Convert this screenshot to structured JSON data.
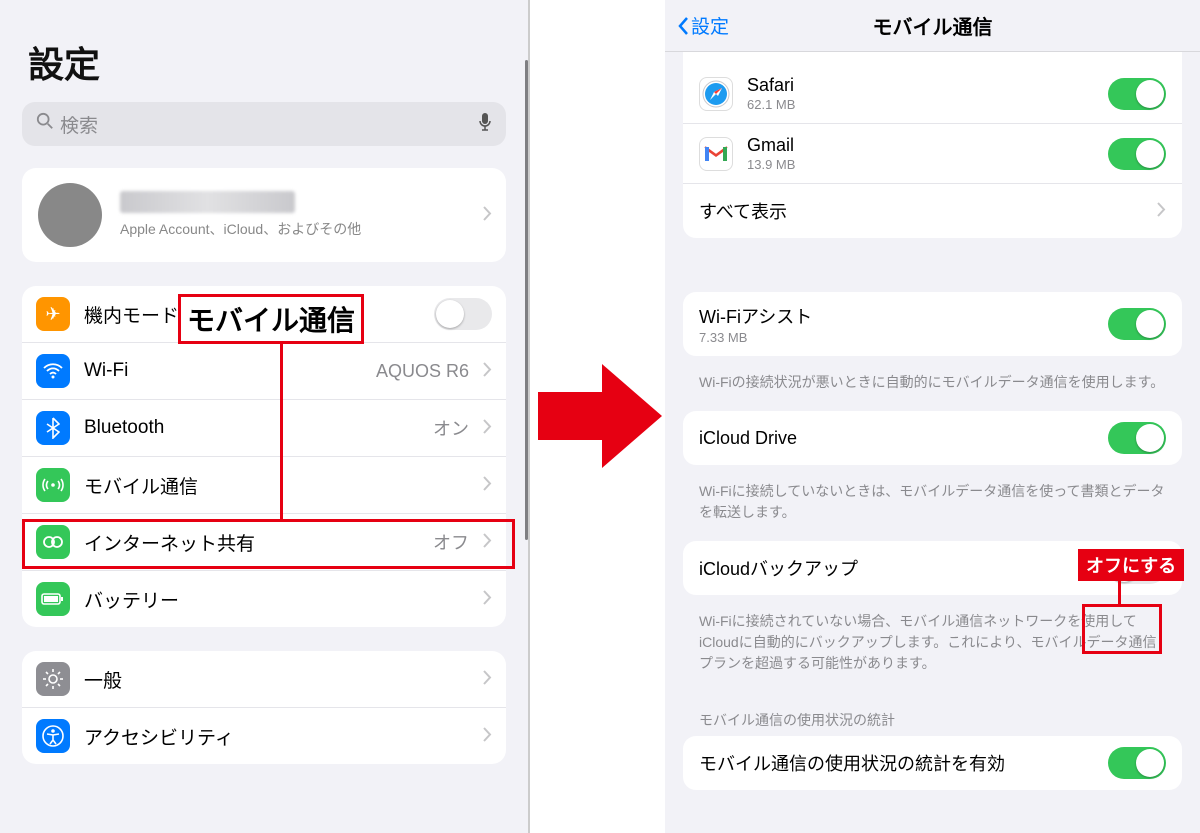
{
  "left": {
    "title": "設定",
    "search_placeholder": "検索",
    "profile_sub": "Apple Account、iCloud、およびその他",
    "items": {
      "airplane": {
        "label": "機内モード",
        "on": false
      },
      "wifi": {
        "label": "Wi-Fi",
        "value": "AQUOS R6"
      },
      "bt": {
        "label": "Bluetooth",
        "value": "オン"
      },
      "cellular": {
        "label": "モバイル通信"
      },
      "hotspot": {
        "label": "インターネット共有",
        "value": "オフ"
      },
      "battery": {
        "label": "バッテリー"
      },
      "general": {
        "label": "一般"
      },
      "accessibility": {
        "label": "アクセシビリティ"
      }
    }
  },
  "right": {
    "back_label": "設定",
    "title": "モバイル通信",
    "apps": {
      "safari": {
        "name": "Safari",
        "size": "62.1 MB",
        "on": true
      },
      "gmail": {
        "name": "Gmail",
        "size": "13.9 MB",
        "on": true
      },
      "show_all": "すべて表示"
    },
    "wifi_assist": {
      "title": "Wi-Fiアシスト",
      "sub": "7.33 MB",
      "on": true,
      "note": "Wi-Fiの接続状況が悪いときに自動的にモバイルデータ通信を使用します。"
    },
    "icloud_drive": {
      "title": "iCloud Drive",
      "on": true,
      "note": "Wi-Fiに接続していないときは、モバイルデータ通信を使って書類とデータを転送します。"
    },
    "icloud_backup": {
      "title": "iCloudバックアップ",
      "on": false,
      "note": "Wi-Fiに接続されていない場合、モバイル通信ネットワークを使用してiCloudに自動的にバックアップします。これにより、モバイルデータ通信プランを超過する可能性があります。"
    },
    "stats_header": "モバイル通信の使用状況の統計",
    "stats_row": "モバイル通信の使用状況の統計を有効"
  },
  "annotations": {
    "callout_main": "モバイル通信",
    "callout_off": "オフにする"
  },
  "colors": {
    "accent": "#007aff",
    "green": "#34c759",
    "red": "#e60012"
  }
}
